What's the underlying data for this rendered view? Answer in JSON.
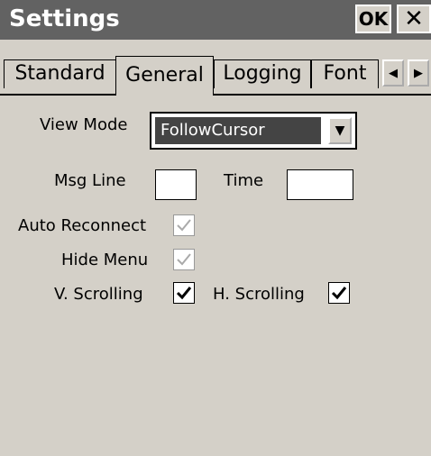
{
  "window": {
    "title": "Settings",
    "ok_label": "OK",
    "close_label": "✕"
  },
  "tabs": [
    {
      "label": "Standard",
      "selected": false
    },
    {
      "label": "General",
      "selected": true
    },
    {
      "label": "Logging",
      "selected": false
    },
    {
      "label": "Font",
      "selected": false
    }
  ],
  "tab_scroll": {
    "left_icon": "◀",
    "right_icon": "▶"
  },
  "form": {
    "view_mode_label": "View Mode",
    "view_mode_value": "FollowCursor",
    "dropdown_arrow": "▼",
    "msg_line_label": "Msg Line",
    "msg_line_value": "",
    "time_label": "Time",
    "time_value": "",
    "auto_reconnect_label": "Auto Reconnect",
    "auto_reconnect_checked": true,
    "auto_reconnect_disabled": true,
    "hide_menu_label": "Hide Menu",
    "hide_menu_checked": true,
    "hide_menu_disabled": true,
    "v_scroll_label": "V. Scrolling",
    "v_scroll_checked": true,
    "h_scroll_label": "H. Scrolling",
    "h_scroll_checked": true
  },
  "colors": {
    "title_bar": "#626262",
    "background": "#d4d0c8",
    "selection": "#444444"
  }
}
